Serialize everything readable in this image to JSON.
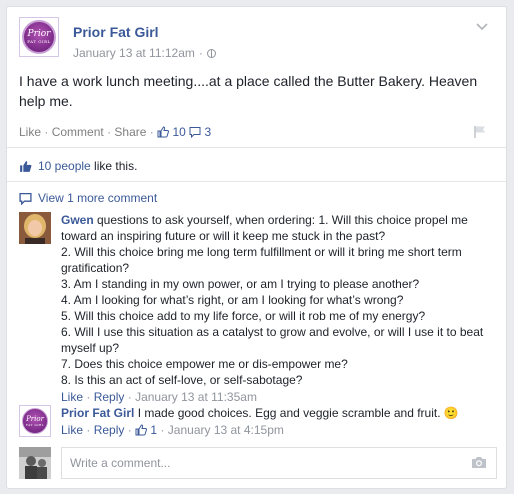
{
  "post": {
    "author": "Prior Fat Girl",
    "logo_text_line1": "Prior",
    "logo_text_line2": "FAT GIRL",
    "timestamp": "January 13 at 11:12am",
    "separator": "·",
    "text": "I have a work lunch meeting....at a place called the Butter Bakery. Heaven help me.",
    "actions": {
      "like": "Like",
      "comment": "Comment",
      "share": "Share",
      "dot": "·",
      "like_count": "10",
      "comment_count": "3"
    }
  },
  "likes": {
    "count_text": "10 people",
    "suffix": " like this."
  },
  "view_more": "View 1 more comment",
  "comments": [
    {
      "author": "Gwen",
      "text": " questions to ask yourself, when ordering: 1. Will this choice propel me toward an inspiring future or will it keep me stuck in the past?",
      "lines": [
        "2. Will this choice bring me long term fulfillment or will it bring me short term gratification?",
        "3. Am I standing in my own power, or am I trying to please another?",
        "4. Am I looking for what’s right, or am I looking for what’s wrong?",
        "5. Will this choice add to my life force, or will it rob me of my energy?",
        "6. Will I use this situation as a catalyst to grow and evolve, or will I use it to beat myself up?",
        "7. Does this choice empower me or dis-empower me?",
        "8. Is this an act of self-love, or self-sabotage?"
      ],
      "like": "Like",
      "reply": "Reply",
      "dot": "·",
      "timestamp": "January 13 at 11:35am"
    },
    {
      "author": "Prior Fat Girl",
      "text": " I made good choices. Egg and veggie scramble and fruit.",
      "emoji": "🙂",
      "like": "Like",
      "reply": "Reply",
      "dot": "·",
      "like_count": "1",
      "timestamp": "January 13 at 4:15pm"
    }
  ],
  "write_comment": {
    "placeholder": "Write a comment..."
  },
  "colors": {
    "link_blue": "#3b5998",
    "muted": "#90949c",
    "brand_purple": "#7a2a87"
  }
}
